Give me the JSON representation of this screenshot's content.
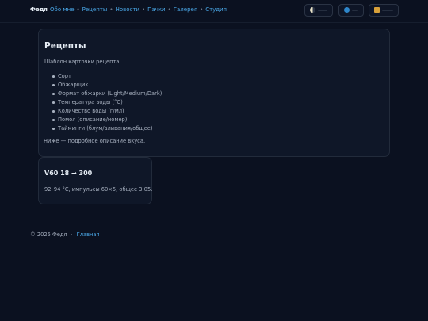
{
  "header": {
    "brand": "Федя",
    "nav": [
      "Обо мне",
      "Рецепты",
      "Новости",
      "Пачки",
      "Галерея",
      "Студия"
    ],
    "controls": [
      {
        "icon": "theme-toggle-icon"
      },
      {
        "icon": "globe-icon"
      },
      {
        "icon": "folder-icon"
      }
    ]
  },
  "main": {
    "title": "Рецепты",
    "intro": "Шаблон карточки рецепта:",
    "fields": [
      "Сорт",
      "Обжарщик",
      "Формат обжарки (Light/Medium/Dark)",
      "Температура воды (°C)",
      "Количество воды (г/мл)",
      "Помол (описание/номер)",
      "Тайминги (блум/вливания/общее)"
    ],
    "outro": "Ниже — подробное описание вкуса."
  },
  "recipe": {
    "title": "V60 18 → 300",
    "text": "92–94 °C, импульсы 60×5, общее 3:05."
  },
  "footer": {
    "copyright": "© 2025 Федя",
    "home_link": "Главная"
  },
  "colors": {
    "background": "#0b1120",
    "card": "#0f1728",
    "link": "#4aa8e8"
  }
}
